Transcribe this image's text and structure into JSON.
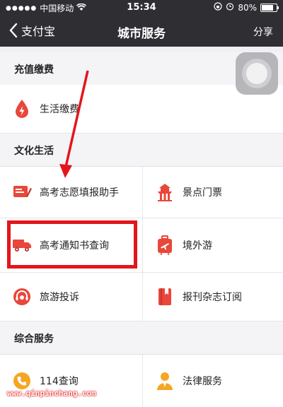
{
  "status_bar": {
    "carrier": "中国移动",
    "time": "15:34",
    "battery_percent": "80%",
    "battery_level": 0.8
  },
  "nav": {
    "back_label": "支付宝",
    "title": "城市服务",
    "share_label": "分享"
  },
  "sections": {
    "recharge": {
      "title": "充值缴费",
      "items": [
        {
          "label": "生活缴费",
          "icon": "drop-lightning-icon"
        }
      ]
    },
    "culture": {
      "title": "文化生活",
      "items": [
        {
          "label": "高考志愿填报助手",
          "icon": "form-pen-icon"
        },
        {
          "label": "景点门票",
          "icon": "temple-icon"
        },
        {
          "label": "高考通知书查询",
          "icon": "truck-icon"
        },
        {
          "label": "境外游",
          "icon": "luggage-plane-icon"
        },
        {
          "label": "旅游投诉",
          "icon": "headset-icon"
        },
        {
          "label": "报刊杂志订阅",
          "icon": "book-icon"
        }
      ]
    },
    "general": {
      "title": "综合服务",
      "items": [
        {
          "label": "114查询",
          "icon": "phone-icon"
        },
        {
          "label": "法律服务",
          "icon": "lawyer-icon"
        }
      ]
    }
  },
  "annotation": {
    "highlight_color": "#e2161c"
  },
  "watermark": "www.qinpinchang.com",
  "colors": {
    "accent_red": "#e8473a",
    "nav_bg": "#2e2e33"
  }
}
